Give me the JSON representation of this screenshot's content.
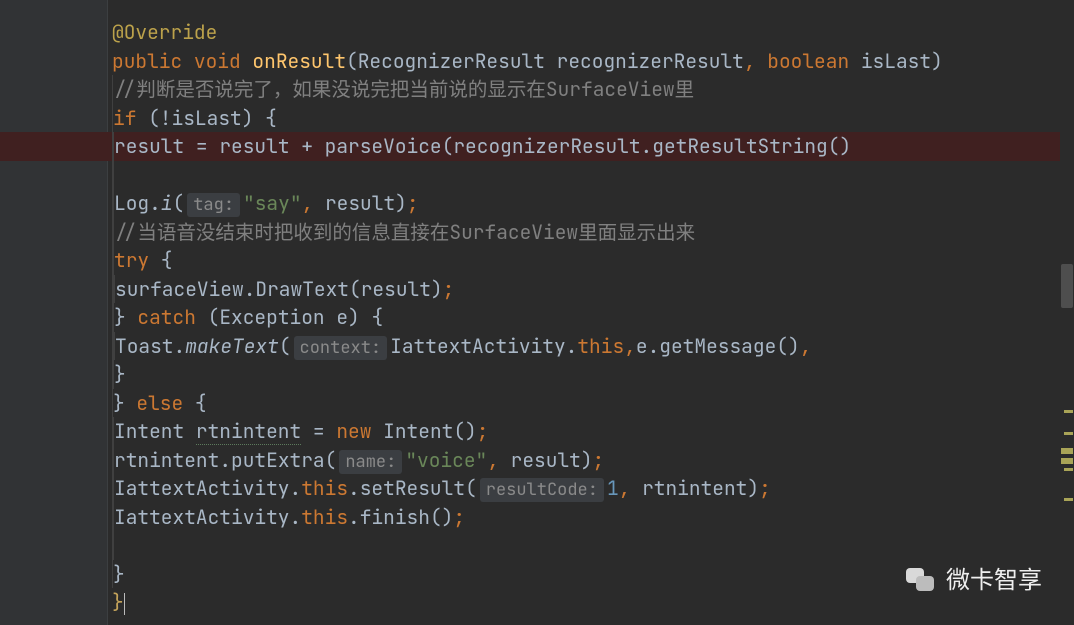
{
  "code": {
    "annot": "@Override",
    "kw_public": "public",
    "kw_void": "void",
    "fn_onResult": "onResult",
    "type_recRes": "RecognizerResult",
    "p_recRes": "recognizerResult",
    "kw_bool": "boolean",
    "p_isLast": "isLast",
    "cm1": "//判断是否说完了，如果没说完把当前说的显示在SurfaceView里",
    "kw_if": "if",
    "id_result": "result",
    "fn_parseVoice": "parseVoice",
    "fn_getResStr": "getResultString",
    "log": "Log",
    "dot": ".",
    "log_i": "i",
    "hint_tag": "tag:",
    "str_say": "\"say\"",
    "cm2": "//当语音没结束时把收到的信息直接在SurfaceView里面显示出来",
    "kw_try": "try",
    "id_surfaceView": "surfaceView",
    "fn_DrawText": "DrawText",
    "kw_catch": "catch",
    "type_Exc": "Exception",
    "p_e": "e",
    "id_Toast": "Toast",
    "fn_makeText": "makeText",
    "hint_context": "context:",
    "id_IattextActivity": "IattextActivity",
    "kw_this": "this",
    "fn_getMessage": "getMessage",
    "kw_else": "else",
    "type_Intent": "Intent",
    "id_rtnintent": "rtnintent",
    "kw_new": "new",
    "fn_putExtra": "putExtra",
    "hint_name": "name:",
    "str_voice": "\"voice\"",
    "fn_setResult": "setResult",
    "hint_resultCode": "resultCode:",
    "num_1": "1",
    "fn_finish": "finish"
  },
  "watermark": {
    "text": "微卡智享"
  }
}
